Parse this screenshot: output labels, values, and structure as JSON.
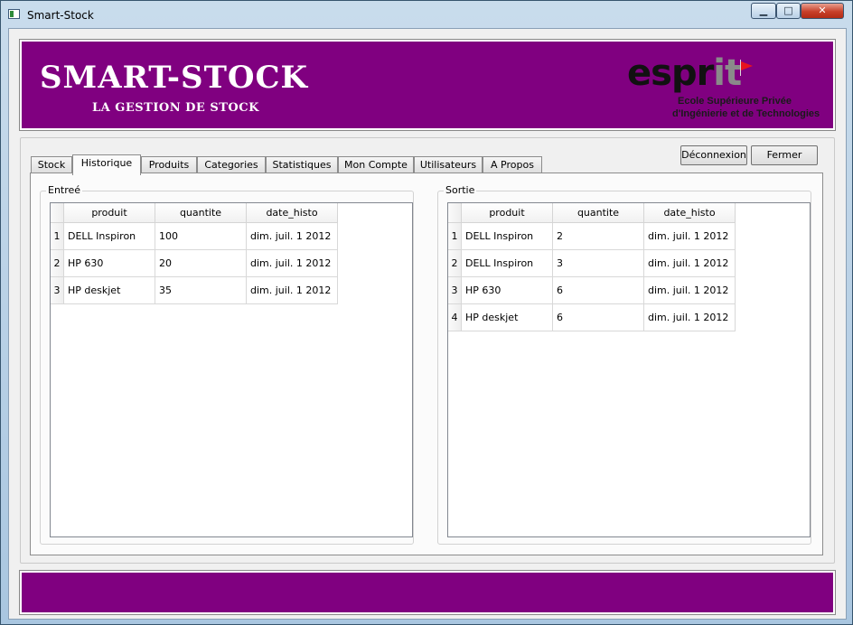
{
  "window": {
    "title": "Smart-Stock",
    "min_label": "▁",
    "max_label": "□",
    "close_label": "✕"
  },
  "banner": {
    "title": "SMART-STOCK",
    "subtitle": "LA GESTION DE STOCK",
    "logo_main": "espr",
    "logo_it": "it",
    "logo_line1": "Ecole Supérieure Privée",
    "logo_line2": "d'Ingénierie et de Technologies",
    "color": "#800080"
  },
  "tabs": [
    "Stock",
    "Historique",
    "Produits",
    "Categories",
    "Statistiques",
    "Mon Compte",
    "Utilisateurs",
    "A Propos"
  ],
  "active_tab": "Historique",
  "buttons": {
    "logout": "Déconnexion",
    "close": "Fermer"
  },
  "entree": {
    "title": "Entreé",
    "columns": [
      "produit",
      "quantite",
      "date_histo"
    ],
    "rows": [
      [
        "1",
        "DELL Inspiron",
        "100",
        "dim. juil. 1 2012"
      ],
      [
        "2",
        "HP 630",
        "20",
        "dim. juil. 1 2012"
      ],
      [
        "3",
        "HP deskjet",
        "35",
        "dim. juil. 1 2012"
      ]
    ]
  },
  "sortie": {
    "title": "Sortie",
    "columns": [
      "produit",
      "quantite",
      "date_histo"
    ],
    "rows": [
      [
        "1",
        "DELL Inspiron",
        "2",
        "dim. juil. 1 2012"
      ],
      [
        "2",
        "DELL Inspiron",
        "3",
        "dim. juil. 1 2012"
      ],
      [
        "3",
        "HP 630",
        "6",
        "dim. juil. 1 2012"
      ],
      [
        "4",
        "HP deskjet",
        "6",
        "dim. juil. 1 2012"
      ]
    ]
  }
}
